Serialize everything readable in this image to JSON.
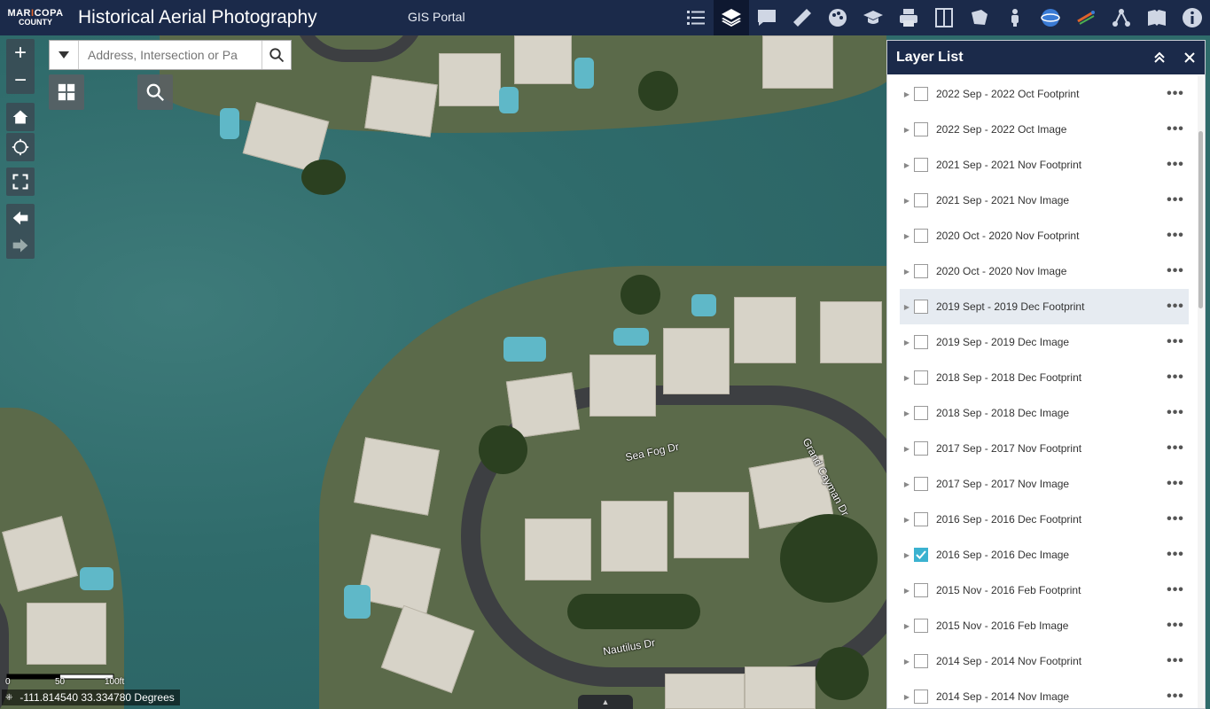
{
  "header": {
    "logo_line1a": "MAR",
    "logo_line1b": "I",
    "logo_line1c": "COPA",
    "logo_line2": "COUNTY",
    "title": "Historical Aerial Photography",
    "portal_link": "GIS Portal"
  },
  "toolbar": {
    "tools": [
      {
        "name": "legend",
        "icon": "list-icon"
      },
      {
        "name": "layer-list",
        "icon": "layers-icon",
        "active": true
      },
      {
        "name": "comments",
        "icon": "chat-icon"
      },
      {
        "name": "measure",
        "icon": "ruler-icon"
      },
      {
        "name": "basemap",
        "icon": "palette-icon"
      },
      {
        "name": "about",
        "icon": "mortarboard-icon"
      },
      {
        "name": "print",
        "icon": "printer-icon"
      },
      {
        "name": "swipe",
        "icon": "swipe-icon"
      },
      {
        "name": "draw",
        "icon": "draw-icon"
      },
      {
        "name": "street-view",
        "icon": "pegman-icon"
      },
      {
        "name": "globe",
        "icon": "globe-icon"
      },
      {
        "name": "satellite",
        "icon": "satellite-icon"
      },
      {
        "name": "share",
        "icon": "share-icon"
      },
      {
        "name": "bookmarks",
        "icon": "book-icon"
      },
      {
        "name": "info",
        "icon": "info-icon"
      }
    ]
  },
  "search": {
    "placeholder": "Address, Intersection or Pa"
  },
  "map": {
    "streets": [
      "Sea Fog Dr",
      "Grand Cayman Dr",
      "Nautilus Dr"
    ],
    "scale_labels": [
      "0",
      "50",
      "100ft"
    ],
    "coordinates": "-111.814540 33.334780 Degrees",
    "bottom_tab": "▲"
  },
  "panel": {
    "title": "Layer List",
    "layers": [
      {
        "name": "2022 Sep - 2022 Oct Footprint",
        "checked": false
      },
      {
        "name": "2022 Sep - 2022 Oct Image",
        "checked": false
      },
      {
        "name": "2021 Sep - 2021 Nov Footprint",
        "checked": false
      },
      {
        "name": "2021 Sep - 2021 Nov Image",
        "checked": false
      },
      {
        "name": "2020 Oct - 2020 Nov Footprint",
        "checked": false
      },
      {
        "name": "2020 Oct - 2020 Nov Image",
        "checked": false
      },
      {
        "name": "2019 Sept - 2019 Dec Footprint",
        "checked": false,
        "hover": true
      },
      {
        "name": "2019 Sep - 2019 Dec Image",
        "checked": false
      },
      {
        "name": "2018 Sep - 2018 Dec Footprint",
        "checked": false
      },
      {
        "name": "2018 Sep - 2018 Dec Image",
        "checked": false
      },
      {
        "name": "2017 Sep - 2017 Nov Footprint",
        "checked": false
      },
      {
        "name": "2017 Sep - 2017 Nov Image",
        "checked": false
      },
      {
        "name": "2016 Sep - 2016 Dec Footprint",
        "checked": false
      },
      {
        "name": "2016 Sep - 2016 Dec Image",
        "checked": true
      },
      {
        "name": "2015 Nov - 2016 Feb Footprint",
        "checked": false
      },
      {
        "name": "2015 Nov - 2016 Feb Image",
        "checked": false
      },
      {
        "name": "2014 Sep - 2014 Nov Footprint",
        "checked": false
      },
      {
        "name": "2014 Sep - 2014 Nov Image",
        "checked": false
      }
    ]
  },
  "colors": {
    "header_bg": "#1b2a4a",
    "checkbox_checked": "#3bb2d0",
    "logo_accent": "#e0632b"
  }
}
